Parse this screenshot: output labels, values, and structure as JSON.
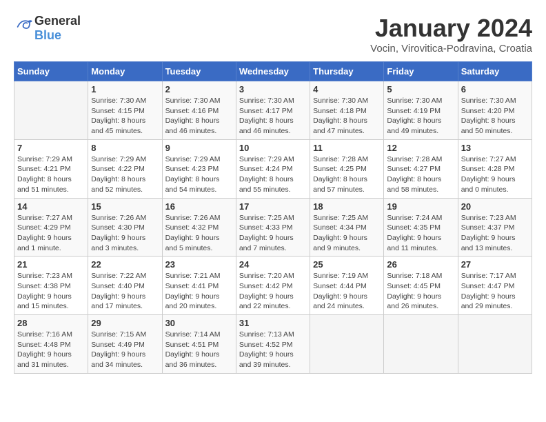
{
  "header": {
    "logo_general": "General",
    "logo_blue": "Blue",
    "title": "January 2024",
    "subtitle": "Vocin, Virovitica-Podravina, Croatia"
  },
  "calendar": {
    "days_of_week": [
      "Sunday",
      "Monday",
      "Tuesday",
      "Wednesday",
      "Thursday",
      "Friday",
      "Saturday"
    ],
    "weeks": [
      [
        {
          "day": "",
          "sunrise": "",
          "sunset": "",
          "daylight": ""
        },
        {
          "day": "1",
          "sunrise": "Sunrise: 7:30 AM",
          "sunset": "Sunset: 4:15 PM",
          "daylight": "Daylight: 8 hours and 45 minutes."
        },
        {
          "day": "2",
          "sunrise": "Sunrise: 7:30 AM",
          "sunset": "Sunset: 4:16 PM",
          "daylight": "Daylight: 8 hours and 46 minutes."
        },
        {
          "day": "3",
          "sunrise": "Sunrise: 7:30 AM",
          "sunset": "Sunset: 4:17 PM",
          "daylight": "Daylight: 8 hours and 46 minutes."
        },
        {
          "day": "4",
          "sunrise": "Sunrise: 7:30 AM",
          "sunset": "Sunset: 4:18 PM",
          "daylight": "Daylight: 8 hours and 47 minutes."
        },
        {
          "day": "5",
          "sunrise": "Sunrise: 7:30 AM",
          "sunset": "Sunset: 4:19 PM",
          "daylight": "Daylight: 8 hours and 49 minutes."
        },
        {
          "day": "6",
          "sunrise": "Sunrise: 7:30 AM",
          "sunset": "Sunset: 4:20 PM",
          "daylight": "Daylight: 8 hours and 50 minutes."
        }
      ],
      [
        {
          "day": "7",
          "sunrise": "Sunrise: 7:29 AM",
          "sunset": "Sunset: 4:21 PM",
          "daylight": "Daylight: 8 hours and 51 minutes."
        },
        {
          "day": "8",
          "sunrise": "Sunrise: 7:29 AM",
          "sunset": "Sunset: 4:22 PM",
          "daylight": "Daylight: 8 hours and 52 minutes."
        },
        {
          "day": "9",
          "sunrise": "Sunrise: 7:29 AM",
          "sunset": "Sunset: 4:23 PM",
          "daylight": "Daylight: 8 hours and 54 minutes."
        },
        {
          "day": "10",
          "sunrise": "Sunrise: 7:29 AM",
          "sunset": "Sunset: 4:24 PM",
          "daylight": "Daylight: 8 hours and 55 minutes."
        },
        {
          "day": "11",
          "sunrise": "Sunrise: 7:28 AM",
          "sunset": "Sunset: 4:25 PM",
          "daylight": "Daylight: 8 hours and 57 minutes."
        },
        {
          "day": "12",
          "sunrise": "Sunrise: 7:28 AM",
          "sunset": "Sunset: 4:27 PM",
          "daylight": "Daylight: 8 hours and 58 minutes."
        },
        {
          "day": "13",
          "sunrise": "Sunrise: 7:27 AM",
          "sunset": "Sunset: 4:28 PM",
          "daylight": "Daylight: 9 hours and 0 minutes."
        }
      ],
      [
        {
          "day": "14",
          "sunrise": "Sunrise: 7:27 AM",
          "sunset": "Sunset: 4:29 PM",
          "daylight": "Daylight: 9 hours and 1 minute."
        },
        {
          "day": "15",
          "sunrise": "Sunrise: 7:26 AM",
          "sunset": "Sunset: 4:30 PM",
          "daylight": "Daylight: 9 hours and 3 minutes."
        },
        {
          "day": "16",
          "sunrise": "Sunrise: 7:26 AM",
          "sunset": "Sunset: 4:32 PM",
          "daylight": "Daylight: 9 hours and 5 minutes."
        },
        {
          "day": "17",
          "sunrise": "Sunrise: 7:25 AM",
          "sunset": "Sunset: 4:33 PM",
          "daylight": "Daylight: 9 hours and 7 minutes."
        },
        {
          "day": "18",
          "sunrise": "Sunrise: 7:25 AM",
          "sunset": "Sunset: 4:34 PM",
          "daylight": "Daylight: 9 hours and 9 minutes."
        },
        {
          "day": "19",
          "sunrise": "Sunrise: 7:24 AM",
          "sunset": "Sunset: 4:35 PM",
          "daylight": "Daylight: 9 hours and 11 minutes."
        },
        {
          "day": "20",
          "sunrise": "Sunrise: 7:23 AM",
          "sunset": "Sunset: 4:37 PM",
          "daylight": "Daylight: 9 hours and 13 minutes."
        }
      ],
      [
        {
          "day": "21",
          "sunrise": "Sunrise: 7:23 AM",
          "sunset": "Sunset: 4:38 PM",
          "daylight": "Daylight: 9 hours and 15 minutes."
        },
        {
          "day": "22",
          "sunrise": "Sunrise: 7:22 AM",
          "sunset": "Sunset: 4:40 PM",
          "daylight": "Daylight: 9 hours and 17 minutes."
        },
        {
          "day": "23",
          "sunrise": "Sunrise: 7:21 AM",
          "sunset": "Sunset: 4:41 PM",
          "daylight": "Daylight: 9 hours and 20 minutes."
        },
        {
          "day": "24",
          "sunrise": "Sunrise: 7:20 AM",
          "sunset": "Sunset: 4:42 PM",
          "daylight": "Daylight: 9 hours and 22 minutes."
        },
        {
          "day": "25",
          "sunrise": "Sunrise: 7:19 AM",
          "sunset": "Sunset: 4:44 PM",
          "daylight": "Daylight: 9 hours and 24 minutes."
        },
        {
          "day": "26",
          "sunrise": "Sunrise: 7:18 AM",
          "sunset": "Sunset: 4:45 PM",
          "daylight": "Daylight: 9 hours and 26 minutes."
        },
        {
          "day": "27",
          "sunrise": "Sunrise: 7:17 AM",
          "sunset": "Sunset: 4:47 PM",
          "daylight": "Daylight: 9 hours and 29 minutes."
        }
      ],
      [
        {
          "day": "28",
          "sunrise": "Sunrise: 7:16 AM",
          "sunset": "Sunset: 4:48 PM",
          "daylight": "Daylight: 9 hours and 31 minutes."
        },
        {
          "day": "29",
          "sunrise": "Sunrise: 7:15 AM",
          "sunset": "Sunset: 4:49 PM",
          "daylight": "Daylight: 9 hours and 34 minutes."
        },
        {
          "day": "30",
          "sunrise": "Sunrise: 7:14 AM",
          "sunset": "Sunset: 4:51 PM",
          "daylight": "Daylight: 9 hours and 36 minutes."
        },
        {
          "day": "31",
          "sunrise": "Sunrise: 7:13 AM",
          "sunset": "Sunset: 4:52 PM",
          "daylight": "Daylight: 9 hours and 39 minutes."
        },
        {
          "day": "",
          "sunrise": "",
          "sunset": "",
          "daylight": ""
        },
        {
          "day": "",
          "sunrise": "",
          "sunset": "",
          "daylight": ""
        },
        {
          "day": "",
          "sunrise": "",
          "sunset": "",
          "daylight": ""
        }
      ]
    ]
  }
}
